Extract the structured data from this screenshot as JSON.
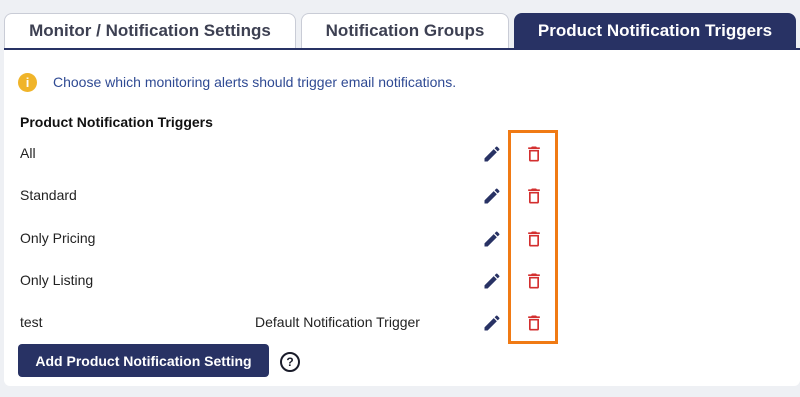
{
  "tabs": [
    {
      "label": "Monitor / Notification Settings",
      "active": false
    },
    {
      "label": "Notification Groups",
      "active": false
    },
    {
      "label": "Product Notification Triggers",
      "active": true
    }
  ],
  "info": {
    "icon": "info-icon",
    "text": "Choose which monitoring alerts should trigger email notifications."
  },
  "section_title": "Product Notification Triggers",
  "triggers": [
    {
      "label": "All",
      "default": ""
    },
    {
      "label": "Standard",
      "default": ""
    },
    {
      "label": "Only Pricing",
      "default": ""
    },
    {
      "label": "Only Listing",
      "default": ""
    },
    {
      "label": "test",
      "default": "Default Notification Trigger"
    }
  ],
  "actions": {
    "edit_icon": "pencil-icon",
    "delete_icon": "trash-icon"
  },
  "add_button_label": "Add Product Notification Setting",
  "help_icon_glyph": "?",
  "colors": {
    "primary": "#283264",
    "edit": "#283264",
    "delete": "#d32f2f",
    "highlight": "#f07a14",
    "info": "#f0b429",
    "info_text": "#2f4a93"
  }
}
